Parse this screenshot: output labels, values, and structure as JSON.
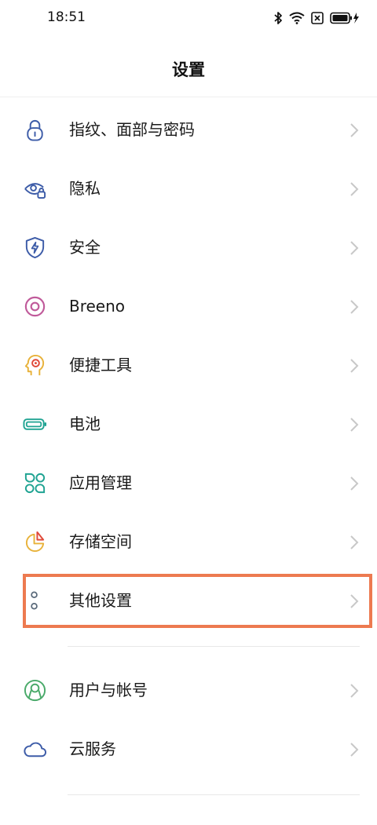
{
  "status_bar": {
    "time": "18:51"
  },
  "header": {
    "title": "设置"
  },
  "colors": {
    "accent_highlight": "#ed7a50",
    "icon_blue": "#3d5ca8",
    "icon_purple": "#c05a9a",
    "icon_yellow": "#e8b23a",
    "icon_teal": "#1fa392",
    "icon_green": "#4aaa6a"
  },
  "settings": {
    "items": [
      {
        "label": "指纹、面部与密码",
        "icon": "lock-icon"
      },
      {
        "label": "隐私",
        "icon": "privacy-eye-icon"
      },
      {
        "label": "安全",
        "icon": "shield-icon"
      },
      {
        "label": "Breeno",
        "icon": "breeno-icon"
      },
      {
        "label": "便捷工具",
        "icon": "head-gear-icon"
      },
      {
        "label": "电池",
        "icon": "battery-icon"
      },
      {
        "label": "应用管理",
        "icon": "apps-grid-icon"
      },
      {
        "label": "存储空间",
        "icon": "pie-chart-icon"
      },
      {
        "label": "其他设置",
        "icon": "dots-icon"
      }
    ],
    "account_items": [
      {
        "label": "用户与帐号",
        "icon": "user-icon"
      },
      {
        "label": "云服务",
        "icon": "cloud-icon"
      }
    ]
  }
}
